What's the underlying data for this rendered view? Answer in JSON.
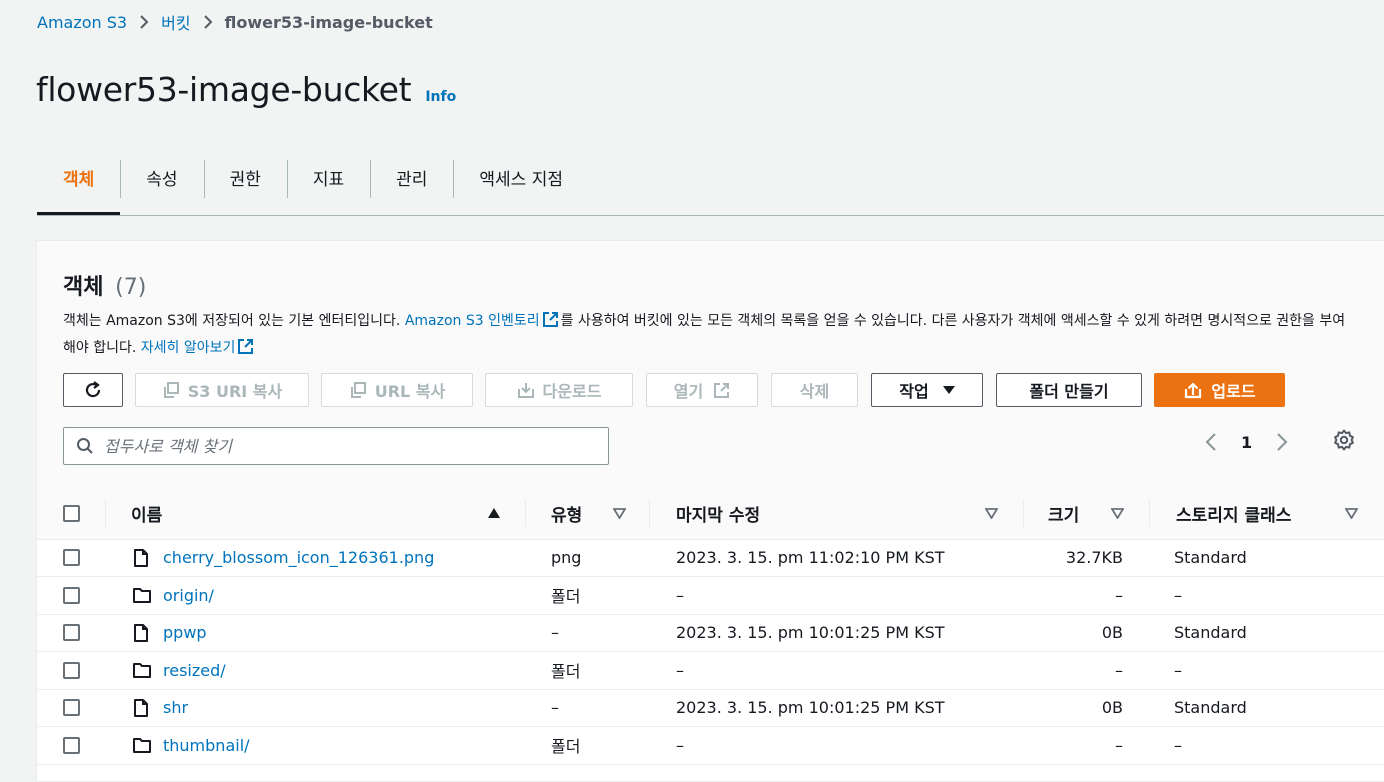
{
  "breadcrumb": {
    "root": "Amazon S3",
    "buckets": "버킷",
    "current": "flower53-image-bucket"
  },
  "page": {
    "title": "flower53-image-bucket",
    "info": "Info"
  },
  "tabs": [
    {
      "label": "객체",
      "active": true
    },
    {
      "label": "속성"
    },
    {
      "label": "권한"
    },
    {
      "label": "지표"
    },
    {
      "label": "관리"
    },
    {
      "label": "액세스 지점"
    }
  ],
  "objects": {
    "title": "객체",
    "count": "(7)",
    "desc_1": "객체는 Amazon S3에 저장되어 있는 기본 엔터티입니다. ",
    "desc_link_1": "Amazon S3 인벤토리",
    "desc_2": "를 사용하여 버킷에 있는 모든 객체의 목록을 얻을 수 있습니다. 다른 사용자가 객체에 액세스할 수 있게 하려면 명시적으로 권한을 부여해야 합니다. ",
    "desc_link_2": "자세히 알아보기"
  },
  "toolbar": {
    "copy_s3_uri": "S3 URI 복사",
    "copy_url": "URL 복사",
    "download": "다운로드",
    "open": "열기",
    "delete": "삭제",
    "actions": "작업",
    "create_folder": "폴더 만들기",
    "upload": "업로드"
  },
  "search": {
    "placeholder": "접두사로 객체 찾기"
  },
  "pagination": {
    "page": "1"
  },
  "table": {
    "columns": [
      "이름",
      "유형",
      "마지막 수정",
      "크기",
      "스토리지 클래스"
    ],
    "rows": [
      {
        "name": "cherry_blossom_icon_126361.png",
        "icon": "file-icon",
        "type": "png",
        "modified": "2023. 3. 15. pm 11:02:10 PM KST",
        "size": "32.7KB",
        "storage": "Standard"
      },
      {
        "name": "origin/",
        "icon": "folder-icon",
        "type": "폴더",
        "modified": "–",
        "size": "–",
        "storage": "–"
      },
      {
        "name": "ppwp",
        "icon": "file-icon",
        "type": "–",
        "modified": "2023. 3. 15. pm 10:01:25 PM KST",
        "size": "0B",
        "storage": "Standard"
      },
      {
        "name": "resized/",
        "icon": "folder-icon",
        "type": "폴더",
        "modified": "–",
        "size": "–",
        "storage": "–"
      },
      {
        "name": "shr",
        "icon": "file-icon",
        "type": "–",
        "modified": "2023. 3. 15. pm 10:01:25 PM KST",
        "size": "0B",
        "storage": "Standard"
      },
      {
        "name": "thumbnail/",
        "icon": "folder-icon",
        "type": "폴더",
        "modified": "–",
        "size": "–",
        "storage": "–"
      }
    ]
  },
  "colors": {
    "accent": "#ec7211",
    "link": "#0073bb"
  }
}
